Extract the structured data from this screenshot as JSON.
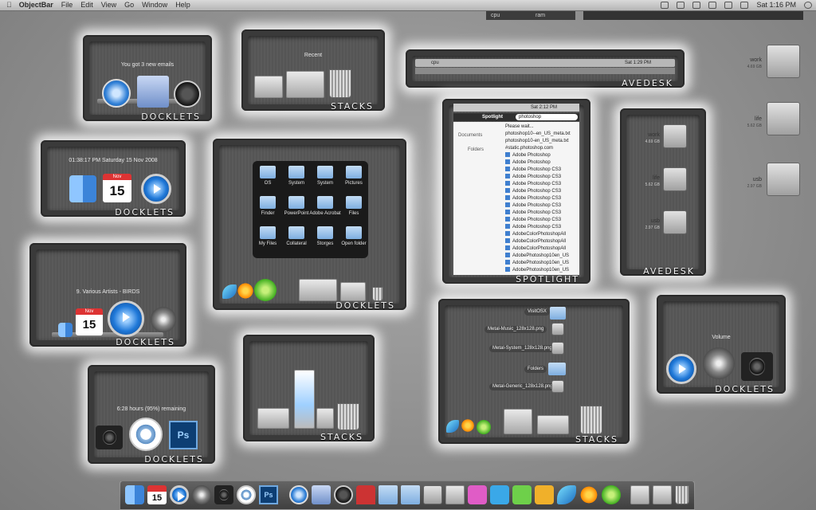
{
  "menubar": {
    "app": "ObjectBar",
    "menus": [
      "File",
      "Edit",
      "View",
      "Go",
      "Window",
      "Help"
    ],
    "clock": "Sat 1:16 PM"
  },
  "status": {
    "cpu": "cpu",
    "ram": "ram"
  },
  "panels": {
    "docklets_label": "DOCKLETS",
    "stacks_label": "STACKS",
    "avedesk_label": "AVEDESK",
    "spotlight_label": "SPOTLIGHT"
  },
  "mail_notice": "You got 3 new emails",
  "recent_label": "Recent",
  "clock_line": "01:38:17 PM Saturday 15 Nov 2008",
  "calendar": {
    "month": "Nov",
    "day": "15"
  },
  "now_playing": "9. Various Artists - BIRDS",
  "battery": "6:28 hours (95%) remaining",
  "volume_label": "Volume",
  "mini_menubar": {
    "clock": "Sat 1:29 PM",
    "cpu": "cpu"
  },
  "stack_popup": [
    {
      "label": "OS"
    },
    {
      "label": "System"
    },
    {
      "label": "System"
    },
    {
      "label": "Pictures"
    },
    {
      "label": "Finder"
    },
    {
      "label": "PowerPoint"
    },
    {
      "label": "Adobe Acrobat"
    },
    {
      "label": "Files"
    },
    {
      "label": "My Files"
    },
    {
      "label": "Collateral"
    },
    {
      "label": "Storges"
    },
    {
      "label": "Open folder"
    }
  ],
  "spotlight": {
    "title": "Spotlight",
    "query": "photoshop",
    "clock": "Sat 2:12 PM",
    "documents_label": "Documents",
    "folders_label": "Folders",
    "rows": [
      "Please wait...",
      "photoshop10--en_US_meta.txt",
      "photoshop10-en_US_meta.txt",
      "#static.photoshop.com",
      "Adobe Photoshop",
      "Adobe Photoshop",
      "Adobe Photoshop CS3",
      "Adobe Photoshop CS3",
      "Adobe Photoshop CS3",
      "Adobe Photoshop CS3",
      "Adobe Photoshop CS3",
      "Adobe Photoshop CS3",
      "Adobe Photoshop CS3",
      "Adobe Photoshop CS3",
      "Adobe Photoshop CS3",
      "AdobeColorPhotoshopAll",
      "AdobeColorPhotoshopAll",
      "AdobeColorPhotoshopAll",
      "AdobePhotoshop10en_US",
      "AdobePhotoshop10en_US",
      "AdobePhotoshop10en_US"
    ]
  },
  "stacks_list": [
    "VisitOSX",
    "Metal-Music_128x128.png",
    "Metal-System_128x128.png",
    "Folders",
    "Metal-Generic_128x128.png"
  ],
  "drives": [
    {
      "name": "work",
      "size": "4.69 GB"
    },
    {
      "name": "life",
      "size": "5.62 GB"
    },
    {
      "name": "usb",
      "size": "2.97 GB"
    }
  ],
  "dock": {
    "calendar_day": "15",
    "ps_label": "Ps"
  }
}
